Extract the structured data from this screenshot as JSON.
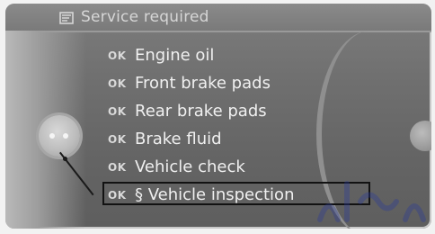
{
  "header": {
    "title": "Service required",
    "icon": "service-document-icon"
  },
  "services": [
    {
      "status": "OK",
      "label": "Engine oil"
    },
    {
      "status": "OK",
      "label": "Front brake pads"
    },
    {
      "status": "OK",
      "label": "Rear brake pads"
    },
    {
      "status": "OK",
      "label": "Brake fluid"
    },
    {
      "status": "OK",
      "label": "Vehicle check"
    },
    {
      "status": "OK",
      "label": "§ Vehicle inspection"
    }
  ],
  "selected_index": 5,
  "colors": {
    "screen_bg": "#6f6f6f",
    "text": "#f0f0f0",
    "status_text": "#d9d9d9",
    "selection_border": "#121212"
  }
}
